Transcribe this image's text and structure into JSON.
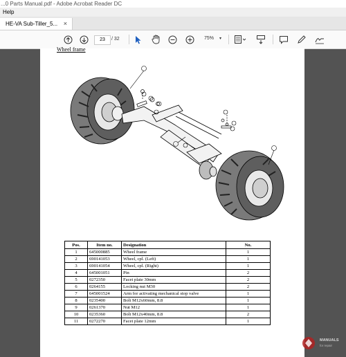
{
  "window": {
    "title": "...0 Parts Manual.pdf - Adobe Acrobat Reader DC"
  },
  "menu": {
    "help": "Help"
  },
  "tab": {
    "label": "HE-VA Sub-Tiller_5...",
    "close": "×"
  },
  "toolbar": {
    "page_current": "23",
    "page_total": "/ 32",
    "zoom": "75%",
    "zoom_caret": "▾"
  },
  "document": {
    "section_title": "Wheel frame",
    "diagram_callouts": [
      "1",
      "2",
      "3",
      "4",
      "5",
      "6",
      "7",
      "8",
      "9",
      "10",
      "11"
    ],
    "table": {
      "headers": [
        "Pos.",
        "Item no.",
        "Designation",
        "No."
      ],
      "rows": [
        [
          "1",
          "645000885",
          "Wheel frame",
          "1"
        ],
        [
          "2",
          "690141053",
          "Wheel, cpl. (Left)",
          "1"
        ],
        [
          "3",
          "690141054",
          "Wheel, cpl. (Right)",
          "1"
        ],
        [
          "4",
          "645001051",
          "Pin",
          "2"
        ],
        [
          "5",
          "0272350",
          "Facet plate 30mm",
          "2"
        ],
        [
          "6",
          "0264155",
          "Locking nut M30",
          "2"
        ],
        [
          "7",
          "645001524",
          "Arm for activating mechanical stop valve",
          "1"
        ],
        [
          "8",
          "0235400",
          "Bolt M12x60mm, 8.8",
          "1"
        ],
        [
          "9",
          "0261370",
          "Nut M12",
          "1"
        ],
        [
          "10",
          "0235360",
          "Bolt M12x40mm, 8.8",
          "2"
        ],
        [
          "11",
          "0272270",
          "Facet plate 12mm",
          "1"
        ]
      ]
    }
  },
  "watermark": {
    "line1": "MANUALS",
    "line2": "for repair"
  }
}
